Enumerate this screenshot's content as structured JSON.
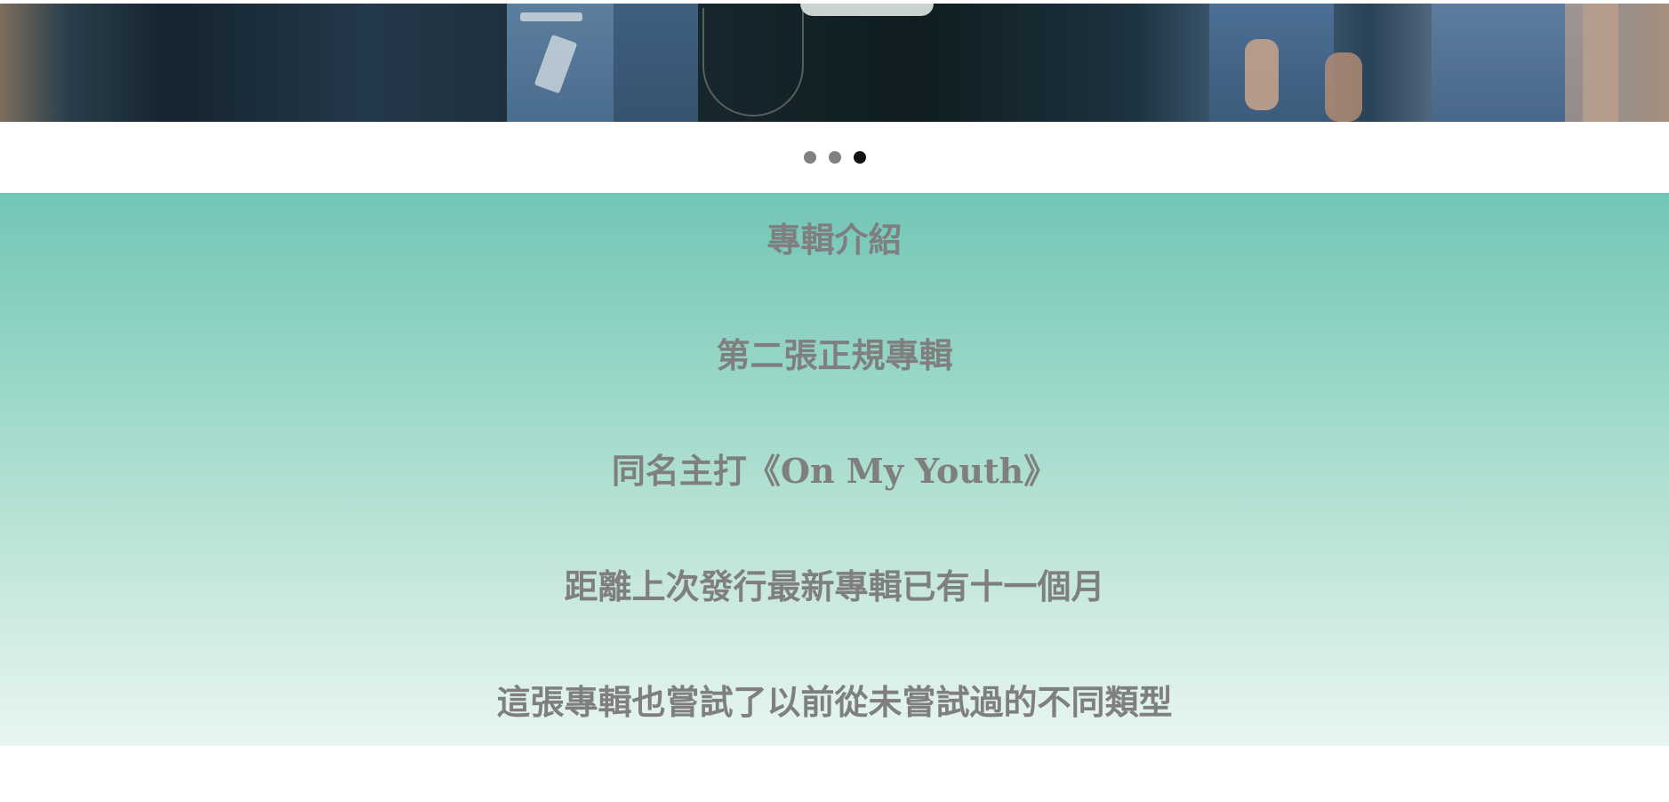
{
  "carousel": {
    "slide_count": 3,
    "active_index": 2,
    "dot_labels": [
      "slide-1",
      "slide-2",
      "slide-3"
    ],
    "dot_color": "#808080",
    "active_dot_color": "#111111"
  },
  "intro": {
    "heading": "專輯介紹",
    "line1": "第二張正規專輯",
    "line2_prefix": "同名主打《",
    "line2_title": "On My Youth",
    "line2_suffix": "》",
    "line3": "距離上次發行最新專輯已有十一個月",
    "line4": "這張專輯也嘗試了以前從未嘗試過的不同類型",
    "text_color": "#7f7f7f",
    "bg_top_color": "#72c6b7",
    "bg_bottom_color": "#e8f6f0"
  }
}
